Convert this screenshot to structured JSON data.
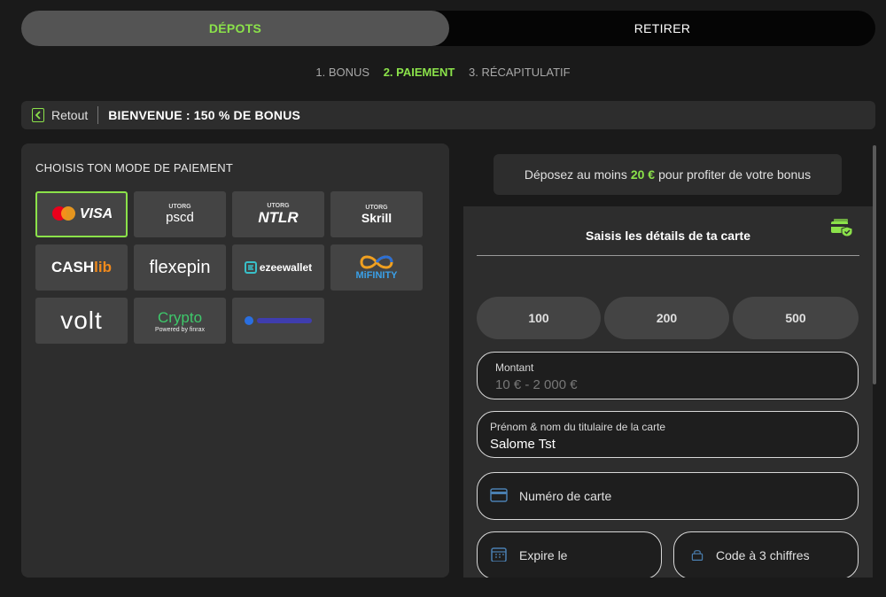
{
  "tabs": {
    "deposit": "DÉPOTS",
    "withdraw": "RETIRER"
  },
  "steps": [
    "1. BONUS",
    "2. PAIEMENT",
    "3. RÉCAPITULATIF"
  ],
  "backbar": {
    "back_label": "Retout",
    "bonus_title": "BIENVENUE : 150 % DE BONUS"
  },
  "payment": {
    "title": "CHOISIS TON MODE DE PAIEMENT",
    "methods": {
      "visa": "VISA",
      "pscd_top": "UTORG",
      "pscd": "pscd",
      "ntlr_top": "UTORG",
      "ntlr": "NTLR",
      "skrill_top": "UTORG",
      "skrill": "Skrill",
      "cashlib_a": "CASH",
      "cashlib_b": "lib",
      "flexepin": "flexepin",
      "ezeewallet": "ezeewallet",
      "mifinity": "MiFINITY",
      "volt": "volt",
      "crypto": "Crypto",
      "crypto_sub": "Powered by finrax"
    }
  },
  "notice": {
    "prefix": "Déposez au moins",
    "amount": "20 €",
    "suffix": "pour profiter de votre bonus"
  },
  "card": {
    "header": "Saisis les détails de ta carte",
    "amounts": [
      "100",
      "200",
      "500"
    ],
    "amount_label": "Montant",
    "amount_placeholder": "10 € - 2 000 €",
    "holder_label": "Prénom & nom du titulaire de la carte",
    "holder_value": "Salome Tst",
    "number_placeholder": "Numéro de carte",
    "expiry_placeholder": "Expire le",
    "cvv_placeholder": "Code à 3 chiffres"
  },
  "colors": {
    "accent": "#8be24a",
    "background": "#1a1a1a",
    "panel": "#2d2d2d"
  }
}
